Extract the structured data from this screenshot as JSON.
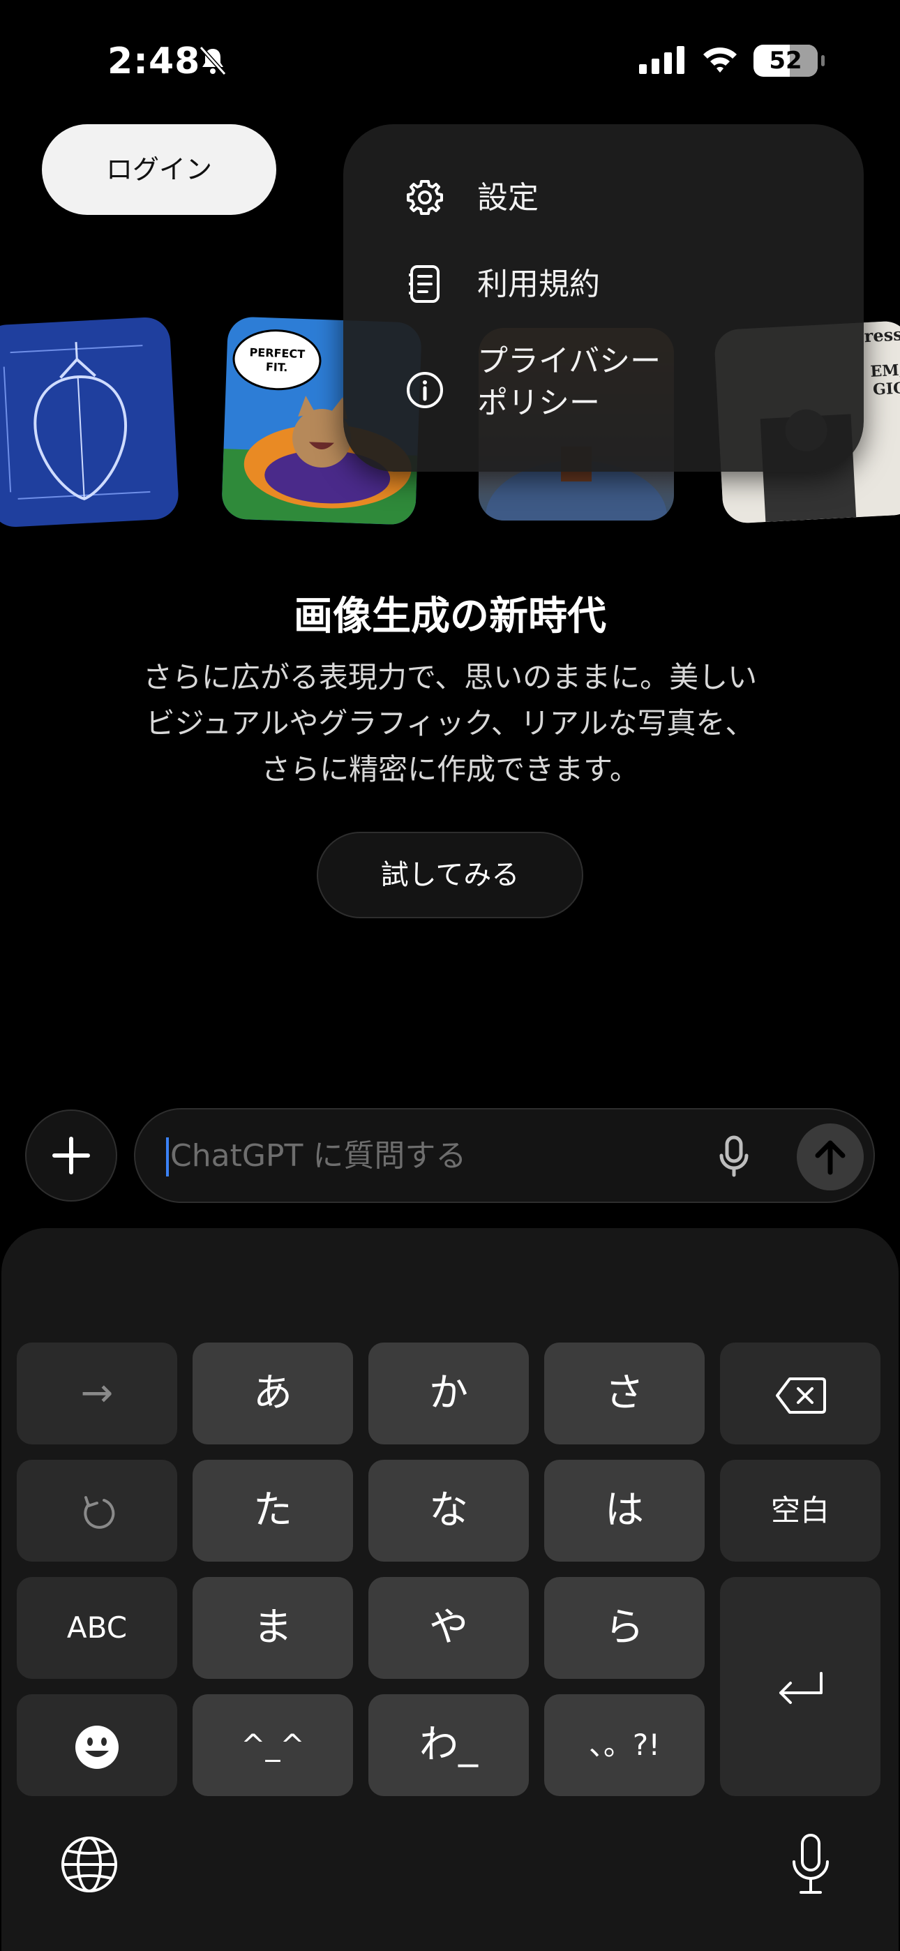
{
  "status_bar": {
    "time": "2:48",
    "battery": "52",
    "icons": [
      "bell-slash-icon",
      "cellular-signal-icon",
      "wifi-icon",
      "battery-icon"
    ]
  },
  "header": {
    "login_label": "ログイン"
  },
  "menu": {
    "items": [
      {
        "label": "設定",
        "icon": "gear-icon"
      },
      {
        "label": "利用規約",
        "icon": "document-icon"
      },
      {
        "label_line1": "プライバシー",
        "label_line2": "ポリシー",
        "icon": "info-icon"
      }
    ]
  },
  "carousel": {
    "cat_bubble_line1": "PERFECT",
    "cat_bubble_line2": "FIT.",
    "news_masthead": "ress",
    "news_headline_1": "EM,",
    "news_headline_2": "GIC"
  },
  "promo": {
    "title": "画像生成の新時代",
    "description_line1": "さらに広がる表現力で、思いのままに。美しい",
    "description_line2": "ビジュアルやグラフィック、リアルな写真を、",
    "description_line3": "さらに精密に作成できます。",
    "try_button": "試してみる"
  },
  "composer": {
    "placeholder": "ChatGPT に質問する",
    "icons": [
      "plus-icon",
      "microphone-icon",
      "arrow-up-icon"
    ]
  },
  "keyboard": {
    "row1": [
      "→",
      "あ",
      "か",
      "さ"
    ],
    "row2": [
      "た",
      "な",
      "は",
      "空白"
    ],
    "row3": [
      "ABC",
      "ま",
      "や",
      "ら"
    ],
    "row4": [
      "^_^",
      "わ_",
      "、。?!"
    ],
    "icons": [
      "delete-icon",
      "undo-icon",
      "return-icon",
      "emoji-icon",
      "globe-icon",
      "dictation-icon"
    ]
  },
  "colors": {
    "background": "#000000",
    "keyboard_bg": "#171717",
    "key_bg": "#3c3c3c",
    "caret": "#3b82f6"
  }
}
